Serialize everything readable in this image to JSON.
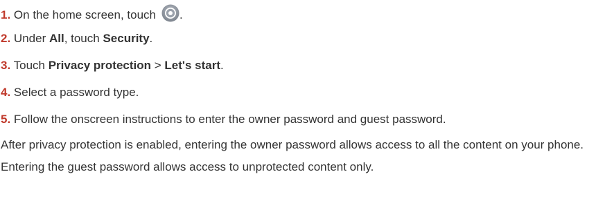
{
  "steps": [
    {
      "num": "1.",
      "pre": "On the home screen, touch",
      "post": "."
    },
    {
      "num": "2.",
      "t1": "Under ",
      "b1": "All",
      "t2": ", touch ",
      "b2": "Security",
      "t3": "."
    },
    {
      "num": "3.",
      "t1": "Touch ",
      "b1": "Privacy protection",
      "t2": " > ",
      "b2": "Let's start",
      "t3": "."
    },
    {
      "num": "4.",
      "text": "Select a password type."
    },
    {
      "num": "5.",
      "text": "Follow the onscreen instructions to enter the owner password and guest password."
    }
  ],
  "note": "After privacy protection is enabled, entering the owner password allows access to all the content on your phone. Entering the guest password allows access to unprotected content only.",
  "icons": {
    "settings": "settings-gear-icon"
  },
  "colors": {
    "step_number": "#c0392b",
    "text": "#333333"
  }
}
